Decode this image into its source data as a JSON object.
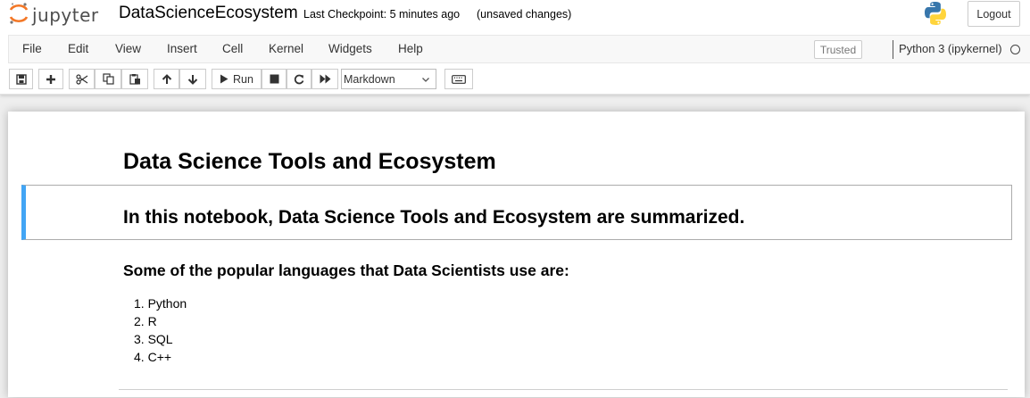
{
  "header": {
    "logo_text": "jupyter",
    "notebook_name": "DataScienceEcosystem",
    "checkpoint": "Last Checkpoint: 5 minutes ago",
    "save_status": "(unsaved changes)",
    "logout_label": "Logout"
  },
  "menubar": {
    "items": [
      "File",
      "Edit",
      "View",
      "Insert",
      "Cell",
      "Kernel",
      "Widgets",
      "Help"
    ],
    "trusted_label": "Trusted",
    "kernel_name": "Python 3 (ipykernel)"
  },
  "toolbar": {
    "run_label": "Run",
    "cell_type": "Markdown"
  },
  "notebook": {
    "title": "Data Science Tools and Ecosystem",
    "intro": "In this notebook, Data Science Tools and Ecosystem are summarized.",
    "languages_heading": "Some of the popular languages that Data Scientists use are:",
    "languages": [
      "Python",
      "R",
      "SQL",
      "C++"
    ]
  },
  "colors": {
    "selected_cell_border": "#42a5f5",
    "jupyter_orange": "#f37726",
    "python_blue": "#3776ab",
    "python_yellow": "#ffd43b"
  }
}
